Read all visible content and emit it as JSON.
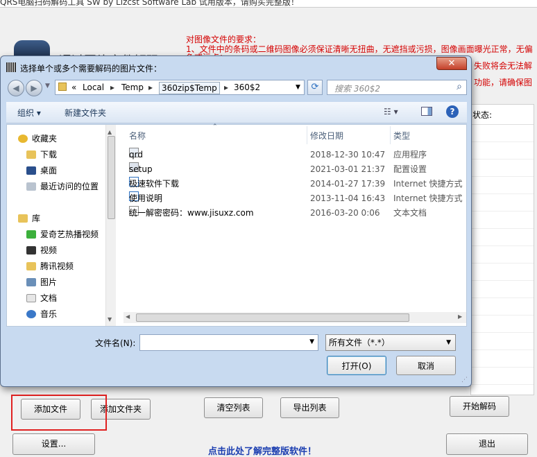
{
  "background_app": {
    "title": "QRS电脑扫码解码工具 SW  by Lizcst Software Lab 试用版本，请购买完整版！",
    "heading": "通过图片文件解码",
    "requirements": [
      "对图像文件的要求：",
      "1、文件中的条码或二维码图像必须保证清晰无扭曲，无遮挡或污损，图像画面曝光正常，无偏",
      "色或污点；",
      "失败将会无法解",
      "功能，请确保图"
    ],
    "status_header": "状态:",
    "buttons": {
      "add_file": "添加文件",
      "add_folder": "添加文件夹",
      "clear_list": "清空列表",
      "export_list": "导出列表",
      "start_decode": "开始解码",
      "settings": "设置...",
      "exit": "退出"
    },
    "promo_link": "点击此处了解完整版软件！"
  },
  "dialog": {
    "title": "选择单个或多个需要解码的图片文件：",
    "close": "✕",
    "address": {
      "overflow": "«",
      "crumbs": [
        "Local",
        "Temp",
        "360zip$Temp",
        "360$2"
      ]
    },
    "search_placeholder": "搜索 360$2",
    "toolbar": {
      "organize": "组织 ▾",
      "new_folder": "新建文件夹"
    },
    "nav": {
      "favorites_label": "收藏夹",
      "favorites": [
        "下载",
        "桌面",
        "最近访问的位置"
      ],
      "library_label": "库",
      "library": [
        "爱奇艺热播视频",
        "视频",
        "腾讯视频",
        "图片",
        "文档",
        "音乐"
      ]
    },
    "columns": {
      "name": "名称",
      "date": "修改日期",
      "type": "类型"
    },
    "files": [
      {
        "name": "qrd",
        "date": "2018-12-30 10:47",
        "type": "应用程序",
        "icon": "application-icon"
      },
      {
        "name": "setup",
        "date": "2021-03-01 21:37",
        "type": "配置设置",
        "icon": "config-icon"
      },
      {
        "name": "极速软件下载",
        "date": "2014-01-27 17:39",
        "type": "Internet 快捷方式",
        "icon": "shortcut-icon"
      },
      {
        "name": "使用说明",
        "date": "2013-11-04 16:43",
        "type": "Internet 快捷方式",
        "icon": "shortcut-icon"
      },
      {
        "name": "统一解密密码：www.jisuxz.com",
        "date": "2016-03-20 0:06",
        "type": "文本文档",
        "icon": "text-file-icon"
      }
    ],
    "filename_label": "文件名(N):",
    "filename_value": "",
    "filter_value": "所有文件（*.*）",
    "open_button": "打开(O)",
    "cancel_button": "取消"
  },
  "colors": {
    "accent_red": "#e02020",
    "promo_blue": "#1a3db0",
    "requirement_red": "#d40000"
  }
}
